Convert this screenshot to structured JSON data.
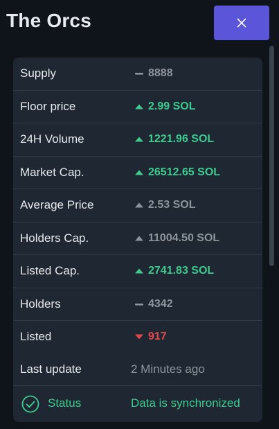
{
  "header": {
    "title": "The Orcs",
    "close_label": "×"
  },
  "colors": {
    "accent": "#5b55d9",
    "up": "#3ecb8f",
    "down": "#e0494b",
    "neutral": "#8d949c"
  },
  "stats": [
    {
      "label": "Supply",
      "value": "8888",
      "trend": "neutral",
      "icon": "dash-icon"
    },
    {
      "label": "Floor price",
      "value": "2.99 SOL",
      "trend": "up",
      "icon": "triangle-up-icon"
    },
    {
      "label": "24H Volume",
      "value": "1221.96 SOL",
      "trend": "up",
      "icon": "triangle-up-icon"
    },
    {
      "label": "Market Cap.",
      "value": "26512.65 SOL",
      "trend": "up",
      "icon": "triangle-up-icon"
    },
    {
      "label": "Average Price",
      "value": "2.53 SOL",
      "trend": "neutral-up",
      "icon": "triangle-up-icon"
    },
    {
      "label": "Holders Cap.",
      "value": "11004.50 SOL",
      "trend": "neutral-up",
      "icon": "triangle-up-icon"
    },
    {
      "label": "Listed Cap.",
      "value": "2741.83 SOL",
      "trend": "up",
      "icon": "triangle-up-icon"
    },
    {
      "label": "Holders",
      "value": "4342",
      "trend": "neutral",
      "icon": "dash-icon"
    },
    {
      "label": "Listed",
      "value": "917",
      "trend": "down",
      "icon": "triangle-down-icon"
    }
  ],
  "last_update": {
    "label": "Last update",
    "value": "2 Minutes ago"
  },
  "status": {
    "label": "Status",
    "value": "Data is synchronized",
    "icon": "check-circle-icon"
  }
}
